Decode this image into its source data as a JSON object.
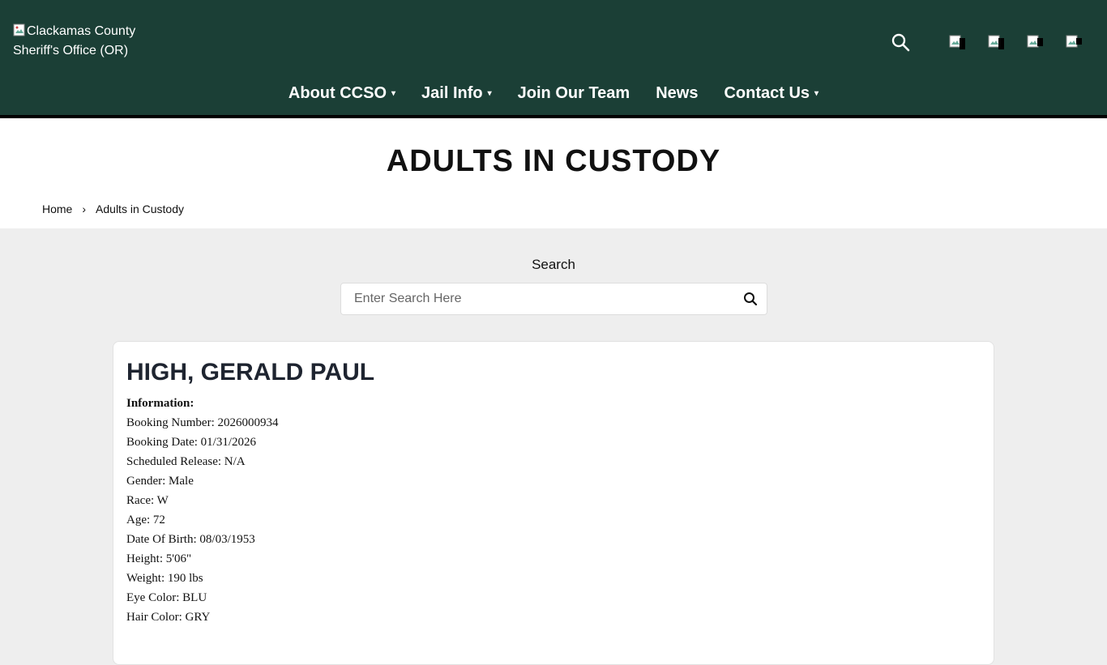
{
  "header": {
    "logo_alt": "Clackamas County Sheriff's Office (OR)",
    "nav": [
      {
        "label": "About CCSO",
        "has_dropdown": true
      },
      {
        "label": "Jail Info",
        "has_dropdown": true
      },
      {
        "label": "Join Our Team",
        "has_dropdown": false
      },
      {
        "label": "News",
        "has_dropdown": false
      },
      {
        "label": "Contact Us",
        "has_dropdown": true
      }
    ],
    "caret": "▾",
    "icons": [
      "search-icon",
      "social-icon",
      "social-icon",
      "social-icon",
      "social-icon"
    ]
  },
  "page": {
    "title": "ADULTS IN CUSTODY",
    "breadcrumb": {
      "home": "Home",
      "separator": "›",
      "current": "Adults in Custody"
    }
  },
  "search": {
    "label": "Search",
    "placeholder": "Enter Search Here"
  },
  "record": {
    "name": "HIGH, GERALD PAUL",
    "info_heading": "Information:",
    "fields": [
      "Booking Number: 2026000934",
      "Booking Date: 01/31/2026",
      "Scheduled Release: N/A",
      "Gender: Male",
      "Race: W",
      "Age: 72",
      "Date Of Birth: 08/03/1953",
      "Height: 5'06\"",
      "Weight: 190 lbs",
      "Eye Color: BLU",
      "Hair Color: GRY"
    ]
  },
  "colors": {
    "header_bg": "#1b3f36",
    "page_bg": "#eeeeee",
    "heading_text": "#1e2430"
  }
}
